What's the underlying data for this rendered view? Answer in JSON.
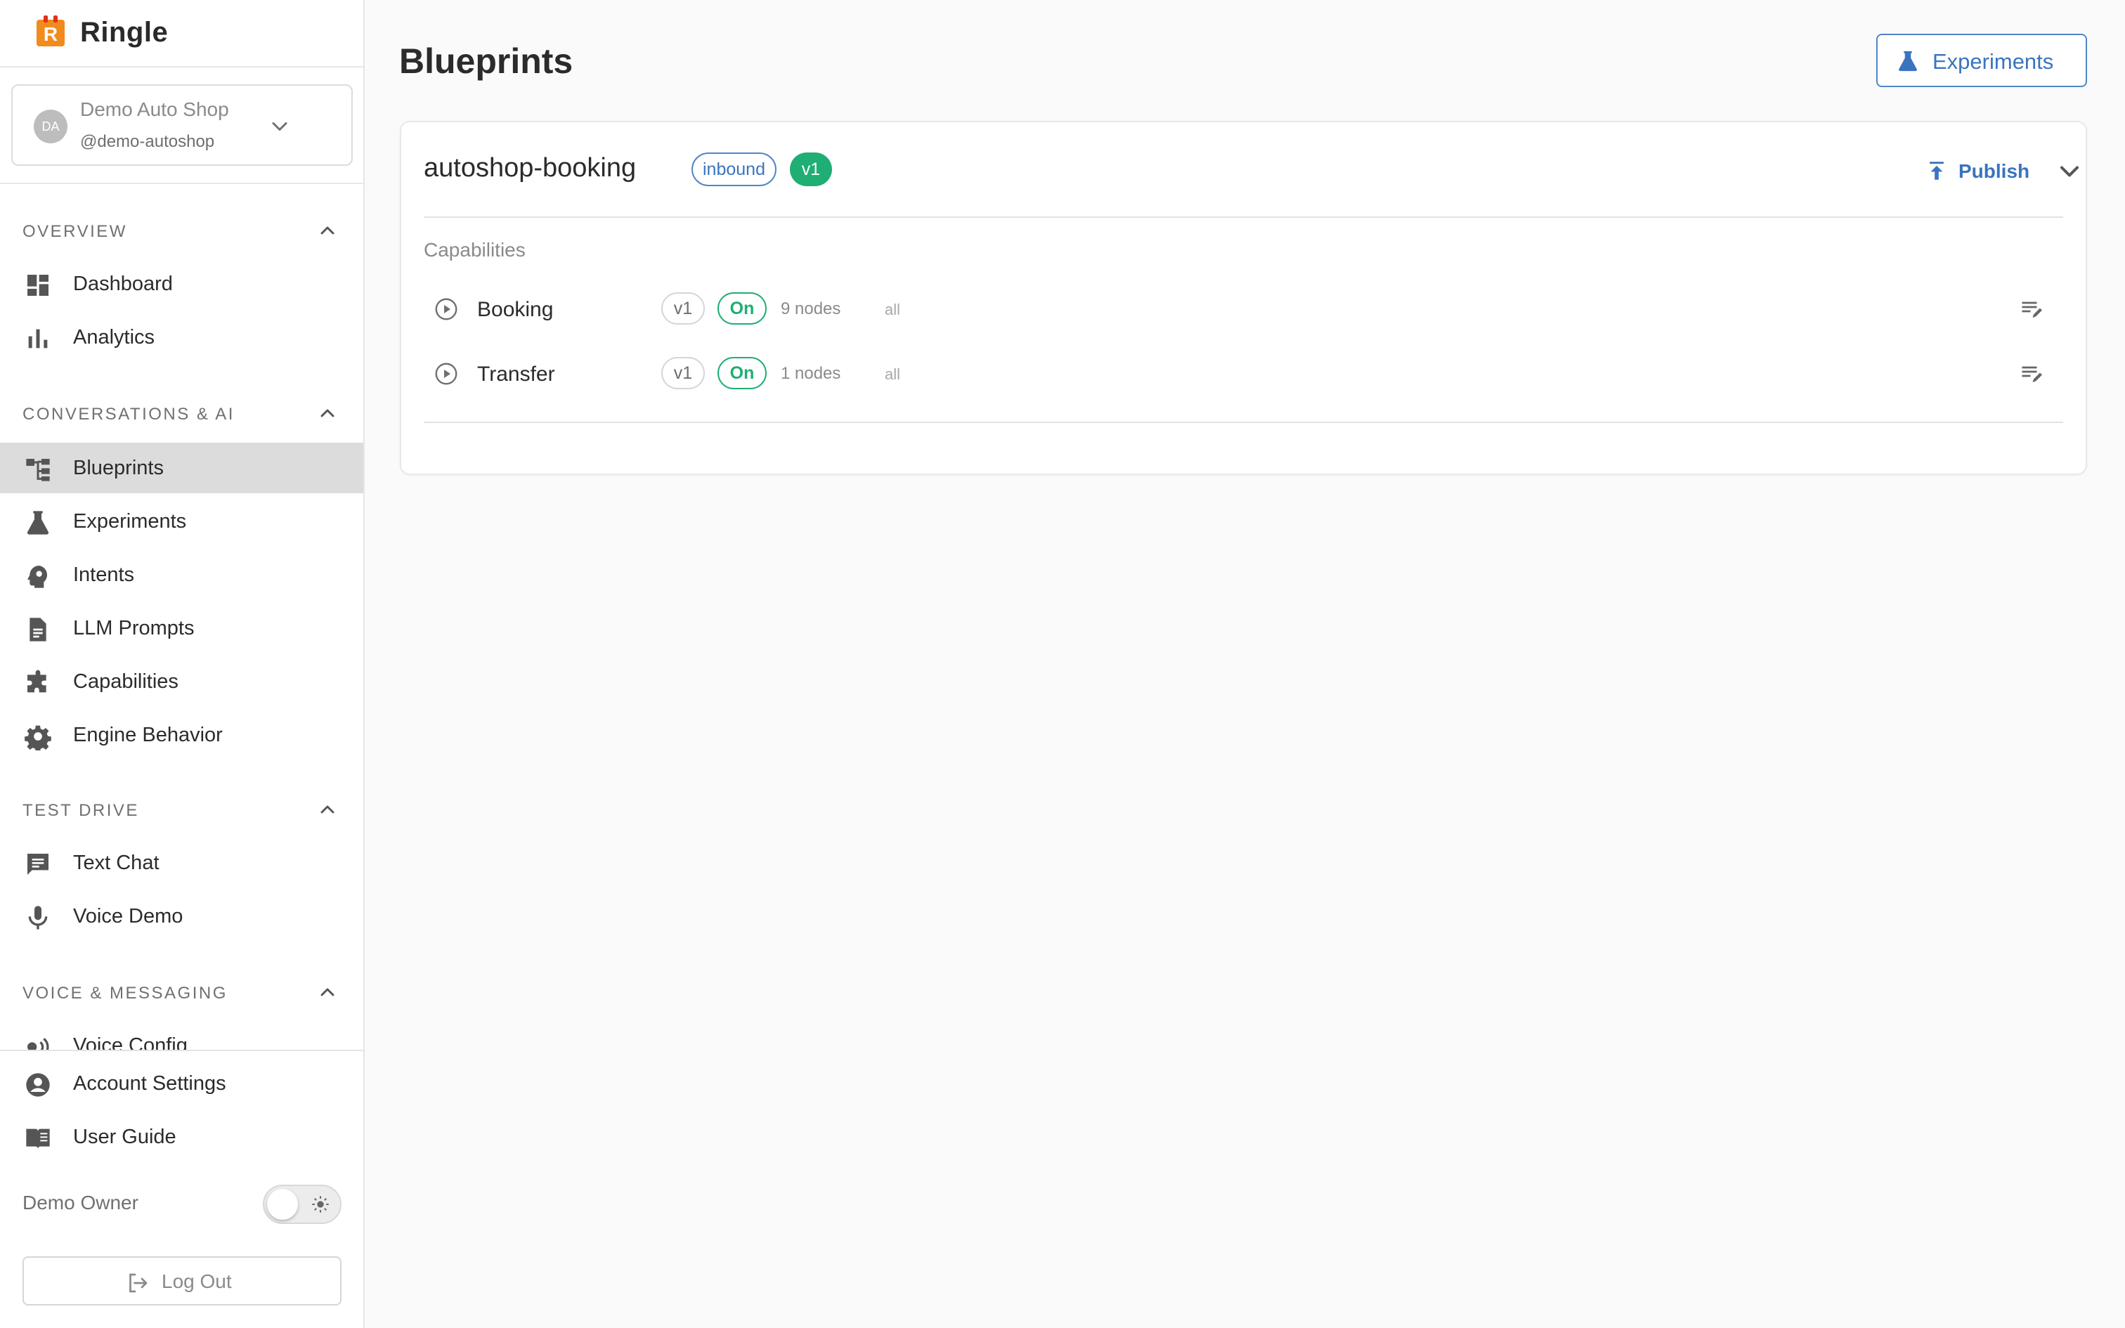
{
  "brand": {
    "name": "Ringle",
    "logo_letter": "R",
    "logo_color": "#f28b1e"
  },
  "account": {
    "avatar_initials": "DA",
    "name": "Demo Auto Shop",
    "handle": "@demo-autoshop"
  },
  "sidebar": {
    "sections": [
      {
        "title": "OVERVIEW",
        "items": [
          {
            "label": "Dashboard",
            "icon": "dashboard-icon"
          },
          {
            "label": "Analytics",
            "icon": "bar-chart-icon"
          }
        ]
      },
      {
        "title": "CONVERSATIONS & AI",
        "items": [
          {
            "label": "Blueprints",
            "icon": "blueprint-tree-icon",
            "active": true
          },
          {
            "label": "Experiments",
            "icon": "flask-icon"
          },
          {
            "label": "Intents",
            "icon": "brain-head-icon"
          },
          {
            "label": "LLM Prompts",
            "icon": "document-icon"
          },
          {
            "label": "Capabilities",
            "icon": "puzzle-icon"
          },
          {
            "label": "Engine Behavior",
            "icon": "gear-icon"
          }
        ]
      },
      {
        "title": "TEST DRIVE",
        "items": [
          {
            "label": "Text Chat",
            "icon": "chat-icon"
          },
          {
            "label": "Voice Demo",
            "icon": "microphone-icon"
          }
        ]
      },
      {
        "title": "VOICE & MESSAGING",
        "items": [
          {
            "label": "Voice Config",
            "icon": "voice-waves-icon"
          }
        ]
      }
    ],
    "bottom": {
      "account_settings": "Account Settings",
      "user_guide": "User Guide",
      "owner": "Demo Owner",
      "theme_toggle_state": "light",
      "logout": "Log Out"
    }
  },
  "main": {
    "title": "Blueprints",
    "experiments_button": "Experiments",
    "blueprint": {
      "name": "autoshop-booking",
      "direction_tag": "inbound",
      "version_tag": "v1",
      "publish_label": "Publish",
      "capabilities_title": "Capabilities",
      "capabilities": [
        {
          "name": "Booking",
          "version": "v1",
          "status": "On",
          "nodes": "9 nodes",
          "scope": "all"
        },
        {
          "name": "Transfer",
          "version": "v1",
          "status": "On",
          "nodes": "1 nodes",
          "scope": "all"
        }
      ]
    }
  },
  "colors": {
    "accent_blue": "#3a74bf",
    "success_green": "#1fae73",
    "active_nav_bg": "#dcdcdc",
    "brand_orange": "#f28b1e"
  }
}
